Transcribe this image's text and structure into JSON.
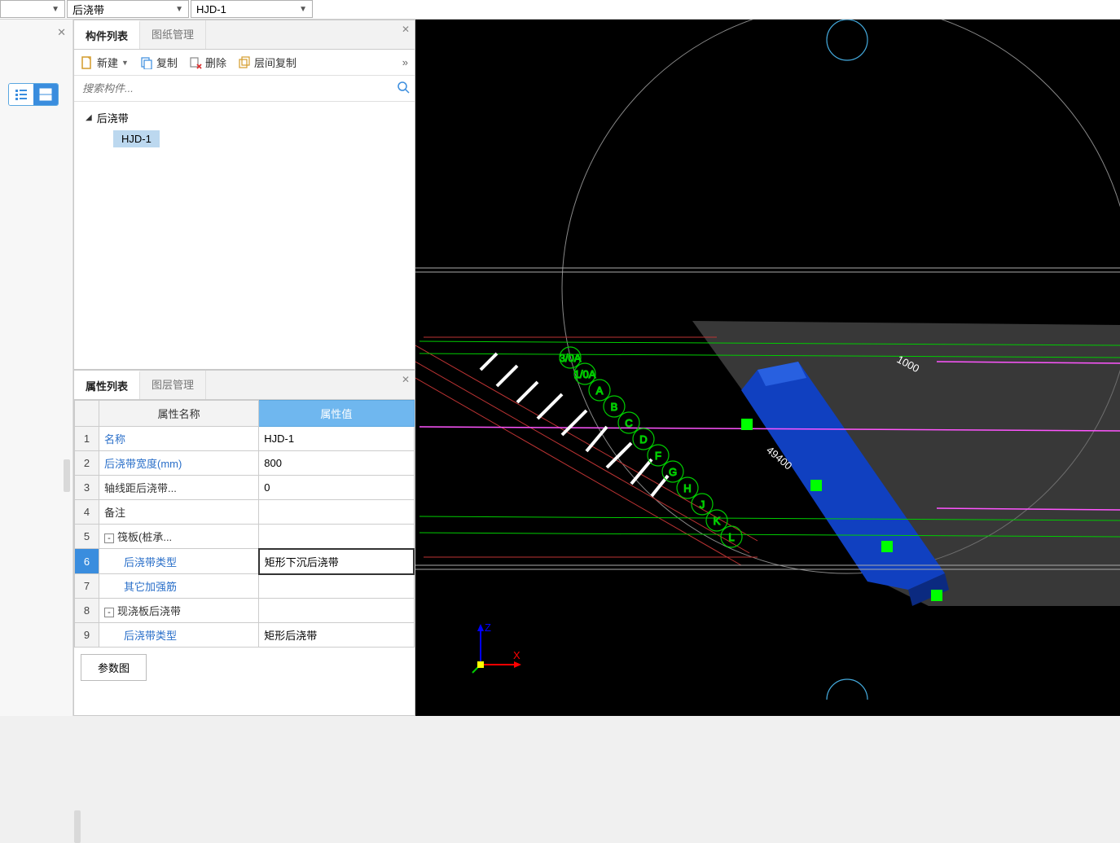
{
  "top": {
    "dd1": "",
    "dd2": "后浇带",
    "dd3": "HJD-1"
  },
  "component_panel": {
    "tab_list": "构件列表",
    "tab_drawing": "图纸管理",
    "tb_new": "新建",
    "tb_copy": "复制",
    "tb_delete": "删除",
    "tb_floorcopy": "层间复制",
    "search_placeholder": "搜索构件...",
    "tree_root": "后浇带",
    "tree_child": "HJD-1"
  },
  "prop_panel": {
    "tab_props": "属性列表",
    "tab_layers": "图层管理",
    "col_name": "属性名称",
    "col_value": "属性值",
    "rows": [
      {
        "n": "1",
        "name": "名称",
        "val": "HJD-1",
        "blue": true
      },
      {
        "n": "2",
        "name": "后浇带宽度(mm)",
        "val": "800",
        "blue": true
      },
      {
        "n": "3",
        "name": "轴线距后浇带...",
        "val": "0"
      },
      {
        "n": "4",
        "name": "备注",
        "val": ""
      },
      {
        "n": "5",
        "name": "筏板(桩承...",
        "val": "",
        "exp": "-"
      },
      {
        "n": "6",
        "name": "后浇带类型",
        "val": "矩形下沉后浇带",
        "blue": true,
        "indent": true,
        "sel": true
      },
      {
        "n": "7",
        "name": "其它加强筋",
        "val": "",
        "blue": true,
        "indent": true
      },
      {
        "n": "8",
        "name": "现浇板后浇带",
        "val": "",
        "exp": "-"
      },
      {
        "n": "9",
        "name": "后浇带类型",
        "val": "矩形后浇带",
        "blue": true,
        "indent": true
      }
    ],
    "param_btn": "参数图"
  },
  "viewport": {
    "labels": [
      "3/0A",
      "1/0A",
      "A",
      "B",
      "C",
      "D",
      "F",
      "G",
      "H",
      "J",
      "K",
      "L"
    ],
    "dim1": "1000",
    "dim2": "49400",
    "axis_x": "X",
    "axis_z": "Z"
  }
}
